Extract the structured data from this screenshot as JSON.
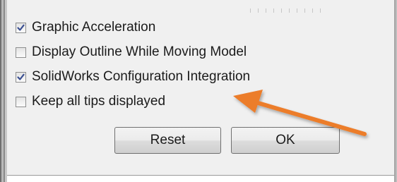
{
  "options": [
    {
      "label": "Graphic Acceleration",
      "checked": true
    },
    {
      "label": "Display Outline While Moving Model",
      "checked": false
    },
    {
      "label": "SolidWorks Configuration Integration",
      "checked": true
    },
    {
      "label": "Keep all tips displayed",
      "checked": false
    }
  ],
  "buttons": {
    "reset": "Reset",
    "ok": "OK"
  },
  "colors": {
    "annotation_arrow": "#ec7d2b",
    "check": "#3b4f91"
  }
}
